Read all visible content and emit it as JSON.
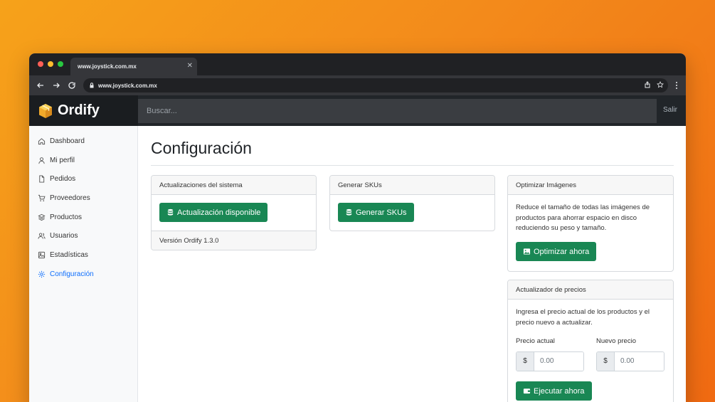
{
  "browser": {
    "tab_title": "www.joystick.com.mx",
    "url": "www.joystick.com.mx",
    "dot_colors": [
      "#ff5f57",
      "#febc2e",
      "#28c840"
    ]
  },
  "app": {
    "brand": "Ordify",
    "search_placeholder": "Buscar...",
    "logout": "Salir"
  },
  "sidebar": {
    "items": [
      {
        "label": "Dashboard",
        "icon": "home-icon"
      },
      {
        "label": "Mi perfil",
        "icon": "user-icon"
      },
      {
        "label": "Pedidos",
        "icon": "file-icon"
      },
      {
        "label": "Proveedores",
        "icon": "cart-icon"
      },
      {
        "label": "Productos",
        "icon": "layers-icon"
      },
      {
        "label": "Usuarios",
        "icon": "users-icon"
      },
      {
        "label": "Estadísticas",
        "icon": "image-icon"
      },
      {
        "label": "Configuración",
        "icon": "gear-icon",
        "active": true
      }
    ]
  },
  "page": {
    "title": "Configuración"
  },
  "updates_card": {
    "header": "Actualizaciones del sistema",
    "button": "Actualización disponible",
    "footer": "Versión Ordify 1.3.0"
  },
  "sku_card": {
    "header": "Generar SKUs",
    "button": "Generar SKUs"
  },
  "images_card": {
    "header": "Optimizar Imágenes",
    "description": "Reduce el tamaño de todas las imágenes de productos para ahorrar espacio en disco reduciendo su peso y tamaño.",
    "button": "Optimizar ahora"
  },
  "price_card": {
    "header": "Actualizador de precios",
    "description": "Ingresa el precio actual de los productos y el precio nuevo a actualizar.",
    "current_label": "Precio actual",
    "new_label": "Nuevo precio",
    "currency": "$",
    "current_placeholder": "0.00",
    "new_placeholder": "0.00",
    "button": "Ejecutar ahora"
  },
  "colors": {
    "primary_green": "#198754",
    "active_blue": "#0d6efd",
    "header_dark": "#212529"
  }
}
